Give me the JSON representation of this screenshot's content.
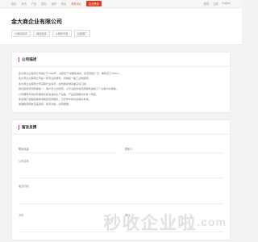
{
  "topbar": {
    "nav": [
      "首页",
      "资讯",
      "产品",
      "招标",
      "百科",
      "商业"
    ],
    "active_label": "商务中心",
    "badge_label": "企业黄页",
    "right": [
      "登录",
      "注册",
      "English"
    ]
  },
  "header": {
    "company_name": "金大商企业有限公司",
    "tags": [
      "小程序制作",
      "网站建设",
      "小程序开发",
      "百度推广"
    ]
  },
  "description": {
    "title": "公司描述",
    "paragraphs": [
      "金大商企业有限公司成立于1992年，总部位于中国珠海市，经营范围广泛，拥有员工4500人。",
      "金大商企业有限公司是一家专业的服务、机械和一般工业制造商。",
      "金大商企业有限公司深耕行业多年，在所属领域具备良好口碑。",
      "我们始终坚持质量第一、客户至上的原则，以专业技术和优质服务赢得了广大客户的信赖。",
      "公司拥有完善的管理体系和先进的生产设备，产品远销国内外多个地区。",
      "未来我们将继续秉承诚信经营的理念，与合作伙伴共创美好未来。",
      "诚邀各界朋友莅临指导，携手共赢，共同发展。"
    ]
  },
  "message": {
    "title": "留言反馈",
    "contact_label": "联系人",
    "contact_placeholder": "联系人",
    "phone_label": "联系电话",
    "phone_placeholder": "联系电话",
    "company_label": "公司名称",
    "company_placeholder": "公司名称",
    "content_label": "留言内容",
    "mobile_label": "手机",
    "email_label": "邮箱"
  },
  "watermark": {
    "text": "秒收企业啦",
    "tld": ".com"
  },
  "colors": {
    "accent": "#e63a1e"
  }
}
